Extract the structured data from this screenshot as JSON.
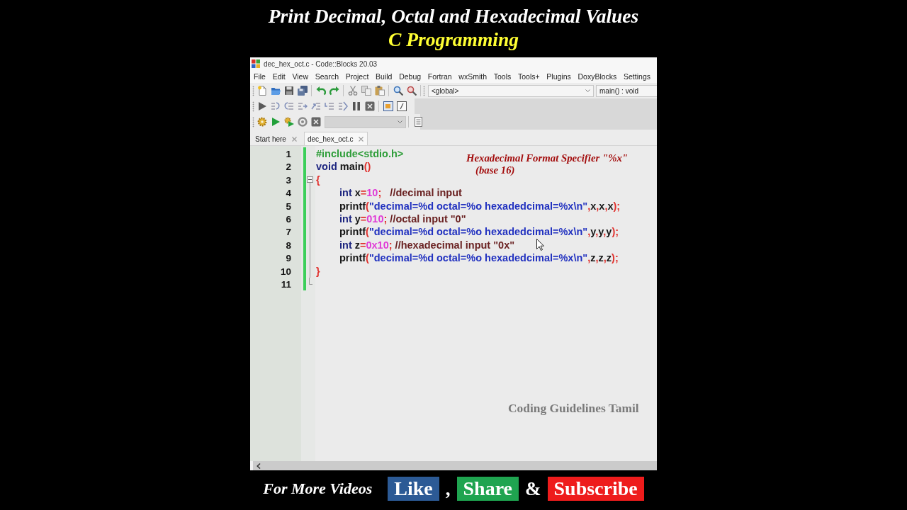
{
  "video": {
    "title": "Print Decimal, Octal and Hexadecimal Values",
    "subtitle": "C Programming"
  },
  "window": {
    "title": "dec_hex_oct.c - Code::Blocks 20.03"
  },
  "menu": [
    "File",
    "Edit",
    "View",
    "Search",
    "Project",
    "Build",
    "Debug",
    "Fortran",
    "wxSmith",
    "Tools",
    "Tools+",
    "Plugins",
    "DoxyBlocks",
    "Settings"
  ],
  "toolbar": {
    "scope": "<global>",
    "function": "main() : void",
    "build_target": {
      "disabled": true
    }
  },
  "tabs": [
    {
      "label": "Start here",
      "selected": false
    },
    {
      "label": "dec_hex_oct.c",
      "selected": true
    }
  ],
  "editor": {
    "lines": [
      {
        "number": "1",
        "changed": true,
        "tokens": [
          {
            "text": "#include<stdio.h>",
            "kind": "preprocessor"
          }
        ]
      },
      {
        "number": "2",
        "changed": true,
        "tokens": [
          {
            "text": "void",
            "kind": "keyword"
          },
          {
            "text": " main",
            "kind": "plain"
          },
          {
            "text": "()",
            "kind": "operator"
          }
        ]
      },
      {
        "number": "3",
        "changed": true,
        "expanded": true,
        "tokens": [
          {
            "text": "{",
            "kind": "operator"
          }
        ],
        "children": [
          {
            "number": "4",
            "changed": true,
            "tokens": [
              {
                "text": "int",
                "kind": "keyword"
              },
              {
                "text": " x",
                "kind": "plain"
              },
              {
                "text": "=",
                "kind": "operator"
              },
              {
                "text": "10",
                "kind": "number"
              },
              {
                "text": ";",
                "kind": "operator"
              },
              {
                "text": "   //decimal input",
                "kind": "comment"
              }
            ]
          },
          {
            "number": "5",
            "changed": true,
            "tokens": [
              {
                "text": "printf",
                "kind": "plain"
              },
              {
                "text": "(",
                "kind": "operator"
              },
              {
                "text": "\"decimal=%d octal=%o hexadedcimal=%x\\n\"",
                "kind": "string"
              },
              {
                "text": ",",
                "kind": "operator"
              },
              {
                "text": "x",
                "kind": "plain"
              },
              {
                "text": ",",
                "kind": "operator"
              },
              {
                "text": "x",
                "kind": "plain"
              },
              {
                "text": ",",
                "kind": "operator"
              },
              {
                "text": "x",
                "kind": "plain"
              },
              {
                "text": ");",
                "kind": "operator"
              }
            ]
          },
          {
            "number": "6",
            "changed": true,
            "tokens": [
              {
                "text": "int",
                "kind": "keyword"
              },
              {
                "text": " y",
                "kind": "plain"
              },
              {
                "text": "=",
                "kind": "operator"
              },
              {
                "text": "010",
                "kind": "number"
              },
              {
                "text": ";",
                "kind": "operator"
              },
              {
                "text": " //octal input \"0\"",
                "kind": "comment"
              }
            ]
          },
          {
            "number": "7",
            "changed": true,
            "tokens": [
              {
                "text": "printf",
                "kind": "plain"
              },
              {
                "text": "(",
                "kind": "operator"
              },
              {
                "text": "\"decimal=%d octal=%o hexadedcimal=%x\\n\"",
                "kind": "string"
              },
              {
                "text": ",",
                "kind": "operator"
              },
              {
                "text": "y",
                "kind": "plain"
              },
              {
                "text": ",",
                "kind": "operator"
              },
              {
                "text": "y",
                "kind": "plain"
              },
              {
                "text": ",",
                "kind": "operator"
              },
              {
                "text": "y",
                "kind": "plain"
              },
              {
                "text": ");",
                "kind": "operator"
              }
            ]
          },
          {
            "number": "8",
            "changed": true,
            "tokens": [
              {
                "text": "int",
                "kind": "keyword"
              },
              {
                "text": " z",
                "kind": "plain"
              },
              {
                "text": "=",
                "kind": "operator"
              },
              {
                "text": "0x10",
                "kind": "number"
              },
              {
                "text": ";",
                "kind": "operator"
              },
              {
                "text": " //hexadecimal input \"0x\"",
                "kind": "comment"
              }
            ]
          },
          {
            "number": "9",
            "changed": true,
            "tokens": [
              {
                "text": "printf",
                "kind": "plain"
              },
              {
                "text": "(",
                "kind": "operator"
              },
              {
                "text": "\"decimal=%d octal=%o hexadedcimal=%x\\n\"",
                "kind": "string"
              },
              {
                "text": ",",
                "kind": "operator"
              },
              {
                "text": "z",
                "kind": "plain"
              },
              {
                "text": ",",
                "kind": "operator"
              },
              {
                "text": "z",
                "kind": "plain"
              },
              {
                "text": ",",
                "kind": "operator"
              },
              {
                "text": "z",
                "kind": "plain"
              },
              {
                "text": ");",
                "kind": "operator"
              }
            ]
          }
        ]
      },
      {
        "number": "10",
        "changed": true,
        "tokens": [
          {
            "text": "}",
            "kind": "operator"
          }
        ]
      },
      {
        "number": "11",
        "changed": true
      }
    ],
    "annotation": [
      "Hexadecimal Format Specifier \"%x\"",
      "(base 16)"
    ],
    "credit": "Coding Guidelines Tamil"
  },
  "footer": {
    "lead": "For More Videos",
    "items": [
      {
        "kind": "badge",
        "text": "Like",
        "color": "#2c5a95"
      },
      {
        "kind": "separator",
        "text": ","
      },
      {
        "kind": "badge",
        "text": "Share",
        "color": "#1fa450"
      },
      {
        "kind": "separator",
        "text": "&"
      },
      {
        "kind": "badge",
        "text": "Subscribe",
        "color": "#ee1c1c"
      }
    ]
  }
}
